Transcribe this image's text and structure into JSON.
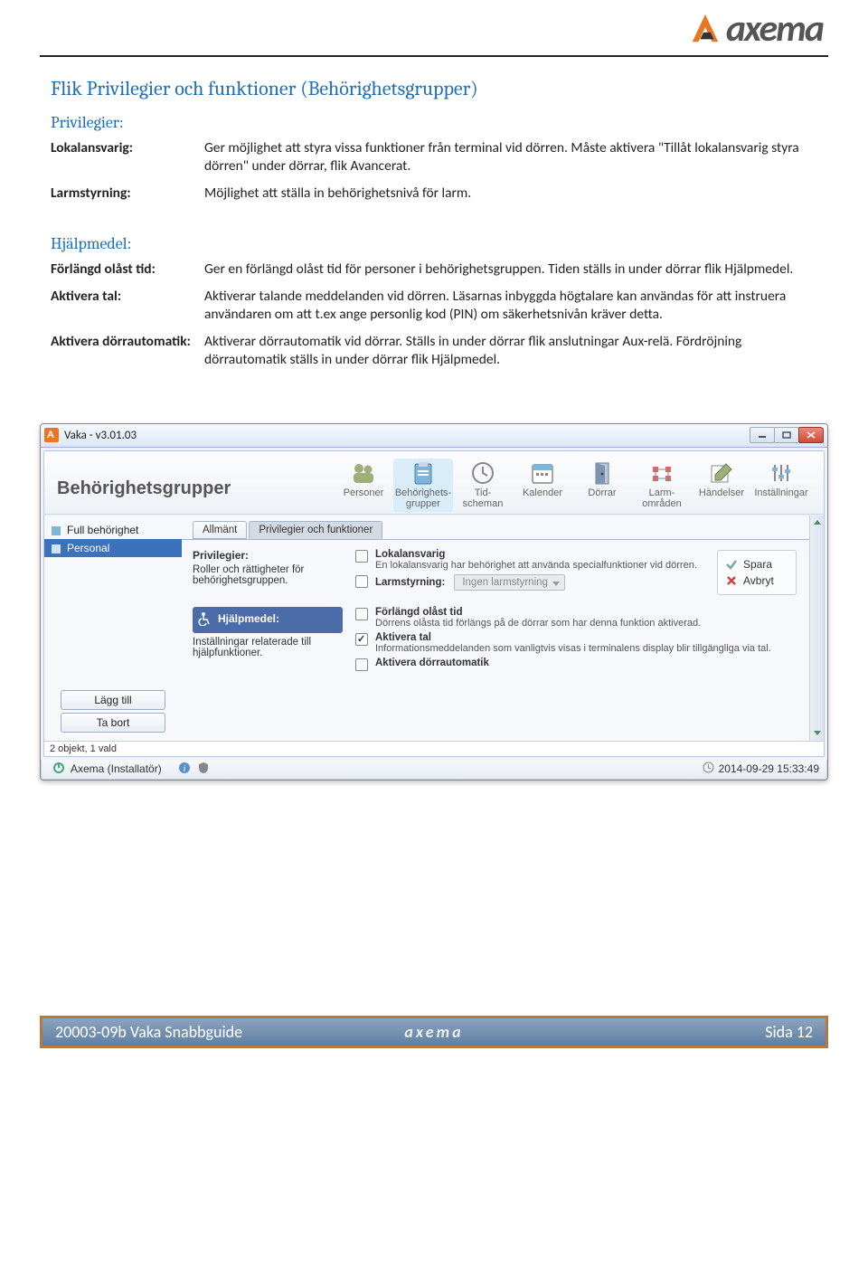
{
  "logo_text": "axema",
  "doc": {
    "heading1": "Flik Privilegier och funktioner (Behörighetsgrupper)",
    "sec_privilegier": "Privilegier:",
    "rows1": [
      {
        "label": "Lokalansvarig:",
        "text": "Ger möjlighet att styra vissa funktioner från terminal vid dörren. Måste aktivera \"Tillåt lokalansvarig styra dörren\" under dörrar, flik Avancerat."
      },
      {
        "label": "Larmstyrning:",
        "text": "Möjlighet att ställa in behörighetsnivå för larm."
      }
    ],
    "sec_hjalpmedel": "Hjälpmedel:",
    "rows2": [
      {
        "label": "Förlängd olåst tid:",
        "text": "Ger en förlängd olåst tid för personer i behörighetsgruppen. Tiden ställs in under dörrar flik Hjälpmedel."
      },
      {
        "label": "Aktivera tal:",
        "text": "Aktiverar talande meddelanden vid dörren. Läsarnas inbyggda högtalare kan användas för att instruera användaren om att t.ex ange personlig kod (PIN) om säkerhetsnivån kräver detta."
      },
      {
        "label": "Aktivera dörrautomatik:",
        "text": "Aktiverar dörrautomatik vid dörrar. Ställs in under dörrar flik anslutningar Aux-relä. Fördröjning dörrautomatik ställs in under dörrar flik Hjälpmedel."
      }
    ]
  },
  "app": {
    "window_title": "Vaka - v3.01.03",
    "page_title": "Behörighetsgrupper",
    "nav": [
      {
        "label": "Personer"
      },
      {
        "label": "Behörighets-\ngrupper"
      },
      {
        "label": "Tid-\nscheman"
      },
      {
        "label": "Kalender"
      },
      {
        "label": "Dörrar"
      },
      {
        "label": "Larm-\nområden"
      },
      {
        "label": "Händelser"
      },
      {
        "label": "Inställningar"
      }
    ],
    "sidebar": {
      "items": [
        "Full behörighet",
        "Personal"
      ],
      "add": "Lägg till",
      "remove": "Ta bort"
    },
    "tabs": [
      "Allmänt",
      "Privilegier och funktioner"
    ],
    "priv": {
      "title": "Privilegier:",
      "desc": "Roller och rättigheter för behörighetsgruppen.",
      "lokal_label": "Lokalansvarig",
      "lokal_desc": "En lokalansvarig har behörighet att använda specialfunktioner vid dörren.",
      "larm_label": "Larmstyrning:",
      "larm_value": "Ingen larmstyrning"
    },
    "hlp": {
      "title": "Hjälpmedel:",
      "desc": "Inställningar relaterade till hjälpfunktioner.",
      "forlangd_label": "Förlängd olåst tid",
      "forlangd_desc": "Dörrens olåsta tid förlängs på de dörrar som har denna funktion aktiverad.",
      "tal_label": "Aktivera tal",
      "tal_desc": "Informationsmeddelanden som vanligtvis visas i terminalens display blir tillgängliga via tal.",
      "auto_label": "Aktivera dörrautomatik"
    },
    "actions": {
      "save": "Spara",
      "cancel": "Avbryt"
    },
    "status_count": "2 objekt, 1 vald",
    "status_user": "Axema (Installatör)",
    "timestamp": "2014-09-29 15:33:49"
  },
  "footer": {
    "left": "20003-09b Vaka Snabbguide",
    "logo": "axema",
    "right": "Sida 12"
  }
}
